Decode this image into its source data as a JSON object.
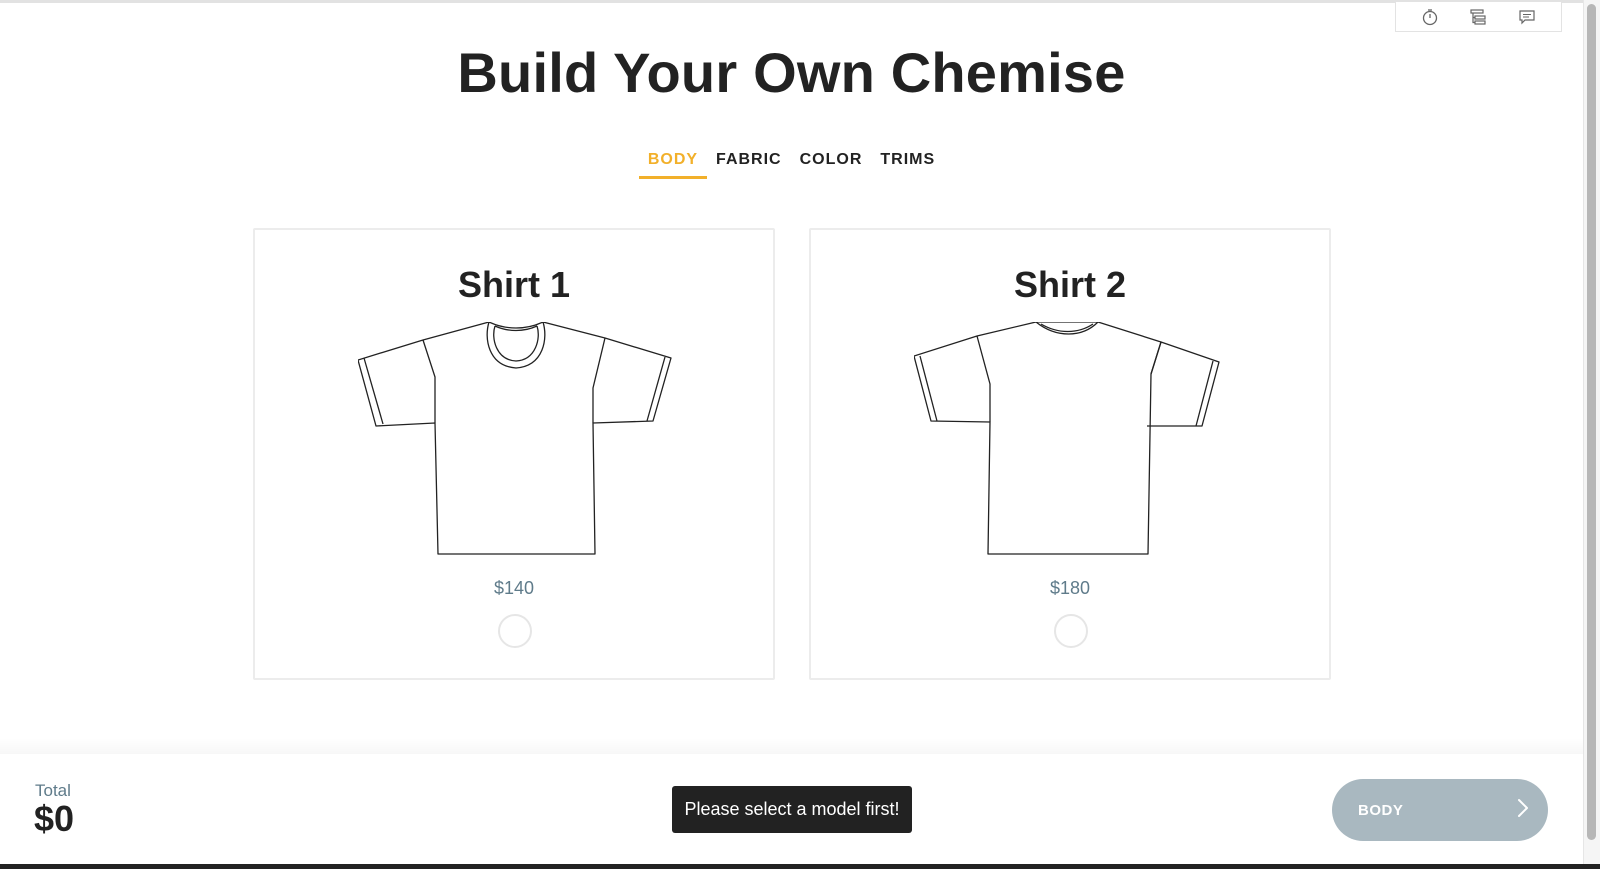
{
  "page": {
    "title": "Build Your Own Chemise"
  },
  "toolbar": {
    "icons": [
      "timer-icon",
      "tree-list-icon",
      "comment-icon"
    ]
  },
  "tabs": [
    {
      "label": "BODY",
      "active": true
    },
    {
      "label": "FABRIC",
      "active": false
    },
    {
      "label": "COLOR",
      "active": false
    },
    {
      "label": "TRIMS",
      "active": false
    }
  ],
  "models": [
    {
      "name": "Shirt 1",
      "price": "$140",
      "selected": false,
      "icon": "crew-neck-tshirt-icon"
    },
    {
      "name": "Shirt 2",
      "price": "$180",
      "selected": false,
      "icon": "scoop-neck-tshirt-icon"
    }
  ],
  "footer": {
    "total_label": "Total",
    "total_value": "$0",
    "toast": "Please select a model first!",
    "next_label": "BODY"
  },
  "colors": {
    "accent": "#f2b02a",
    "price": "#5f7b8a",
    "button_disabled": "#a9b8c0",
    "toast_bg": "#222222"
  }
}
